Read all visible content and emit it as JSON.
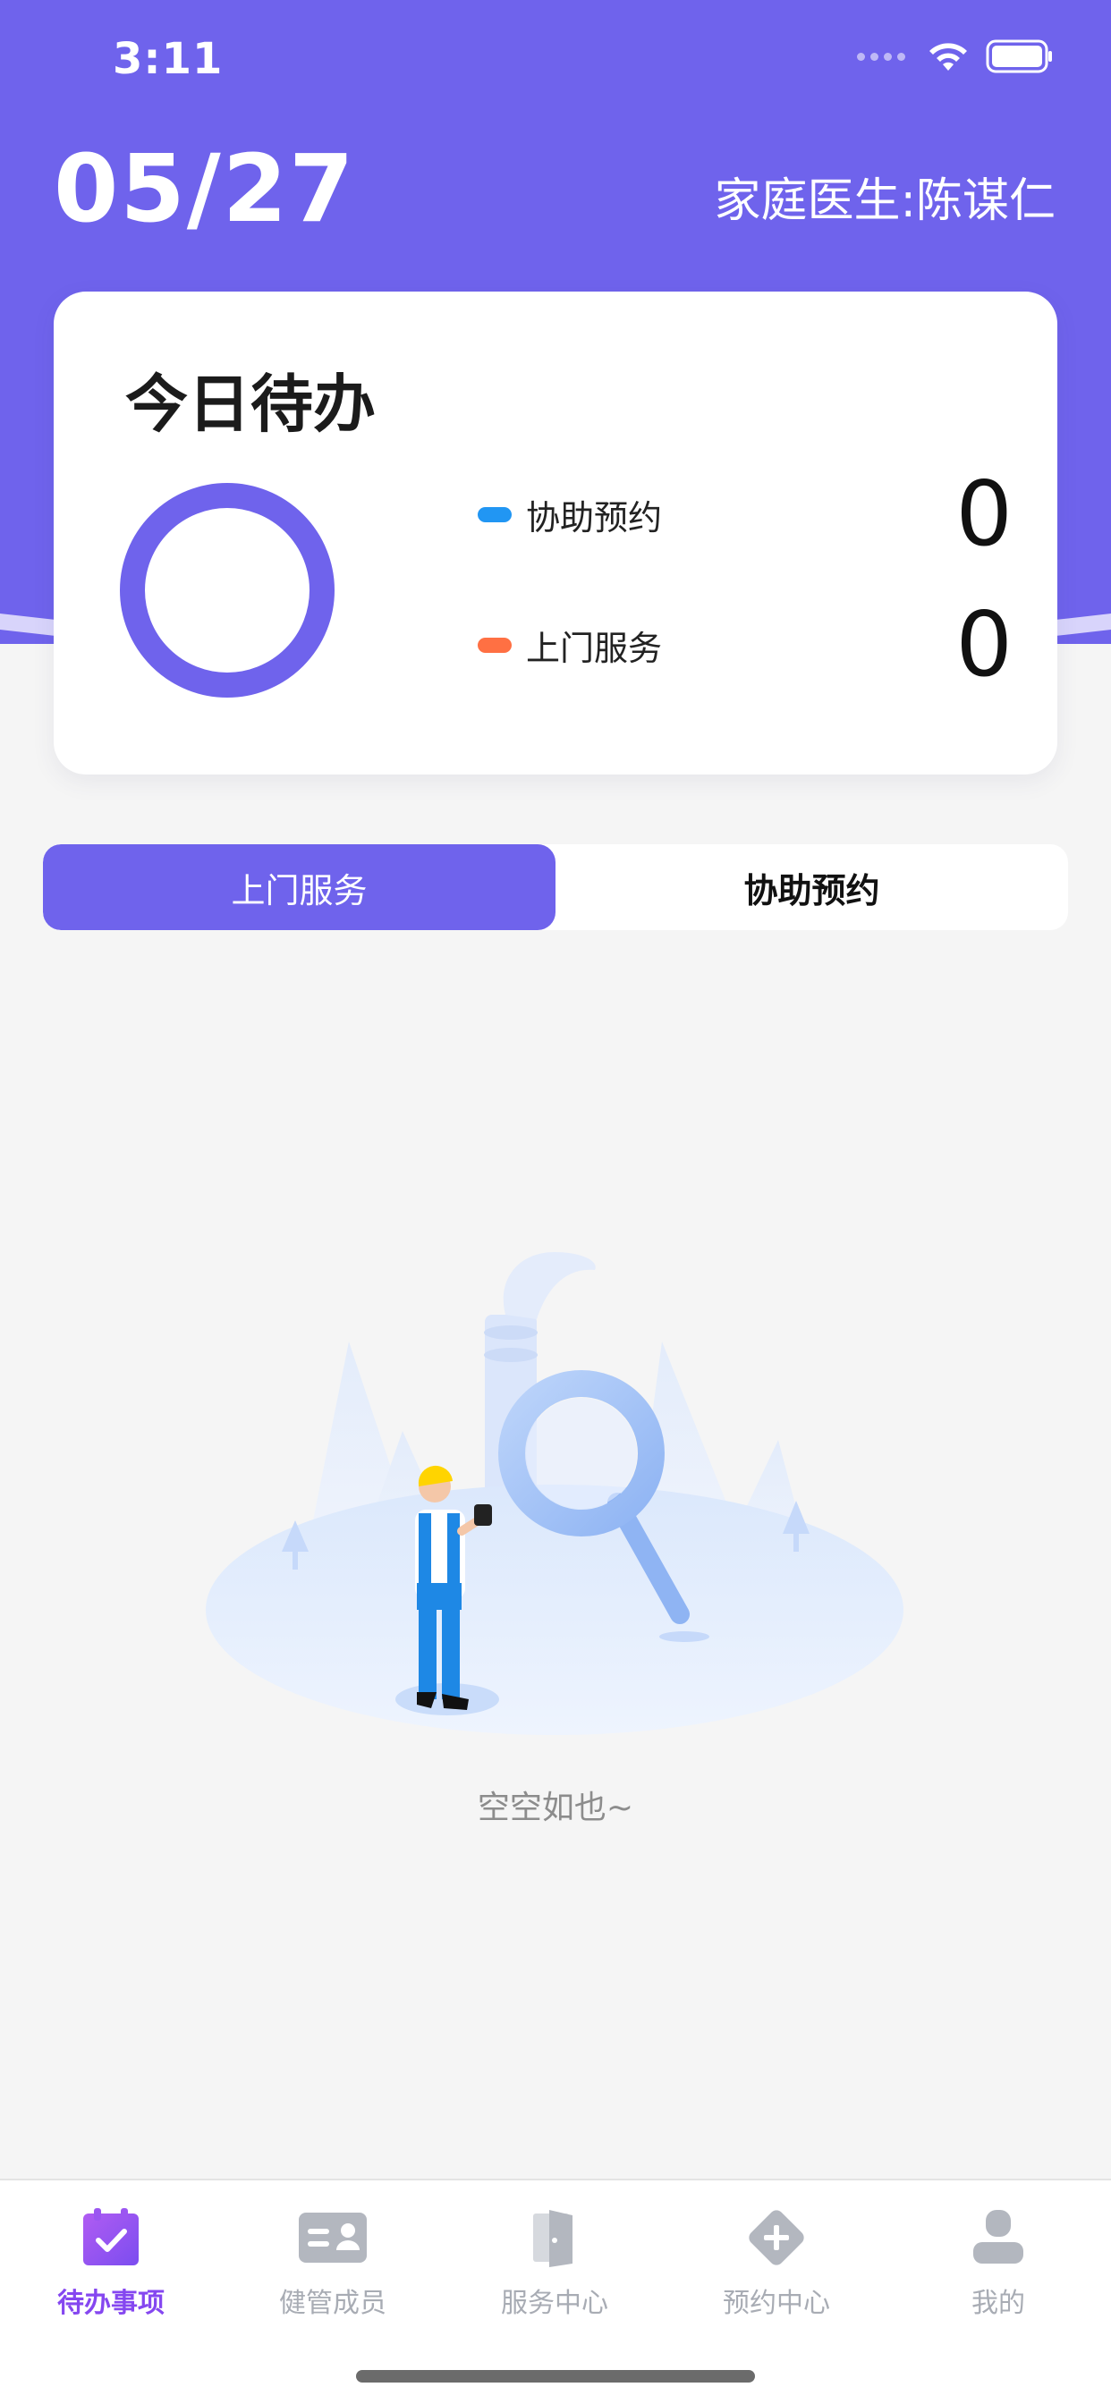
{
  "status_bar": {
    "time": "3:11"
  },
  "header": {
    "date": "05/27",
    "doctor": "家庭医生:陈谋仁"
  },
  "today_card": {
    "title": "今日待办",
    "items": [
      {
        "label": "协助预约",
        "count": "0",
        "color": "#2196f3"
      },
      {
        "label": "上门服务",
        "count": "0",
        "color": "#ff7043"
      }
    ],
    "ring_color": "#6f63ec"
  },
  "tabs": [
    {
      "label": "上门服务",
      "active": true
    },
    {
      "label": "协助预约",
      "active": false
    }
  ],
  "empty_state": {
    "text": "空空如也~"
  },
  "bottom_nav": [
    {
      "label": "待办事项",
      "icon": "calendar-check-icon",
      "active": true
    },
    {
      "label": "健管成员",
      "icon": "id-card-icon",
      "active": false
    },
    {
      "label": "服务中心",
      "icon": "door-icon",
      "active": false
    },
    {
      "label": "预约中心",
      "icon": "plus-diamond-icon",
      "active": false
    },
    {
      "label": "我的",
      "icon": "user-icon",
      "active": false
    }
  ],
  "colors": {
    "primary": "#6f63ec",
    "active_nav": "#8547f0",
    "inactive_nav": "#a8acb4",
    "background": "#f5f5f5"
  }
}
